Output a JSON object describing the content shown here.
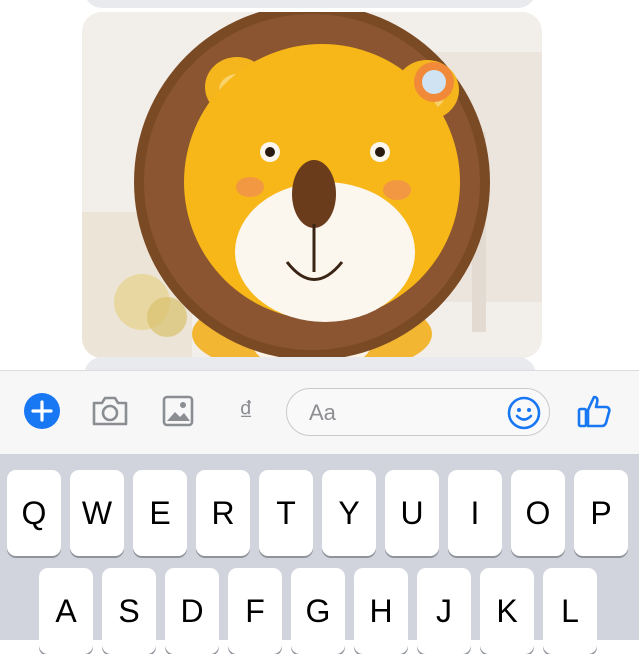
{
  "composer": {
    "placeholder": "Aa",
    "icons": {
      "add": "plus-circle-icon",
      "camera": "camera-icon",
      "gallery": "photo-icon",
      "currency": "dong-sign-icon",
      "emoji": "smiley-icon",
      "like": "thumbs-up-icon"
    },
    "currency_glyph": "₫",
    "accent": "#1877f2"
  },
  "keyboard": {
    "row1": [
      "Q",
      "W",
      "E",
      "R",
      "T",
      "Y",
      "U",
      "I",
      "O",
      "P"
    ],
    "row2": [
      "A",
      "S",
      "D",
      "F",
      "G",
      "H",
      "J",
      "K",
      "L"
    ]
  },
  "colors": {
    "bubble": "#e9eaee",
    "keyboard_bg": "#d1d4dc",
    "key": "#ffffff"
  }
}
